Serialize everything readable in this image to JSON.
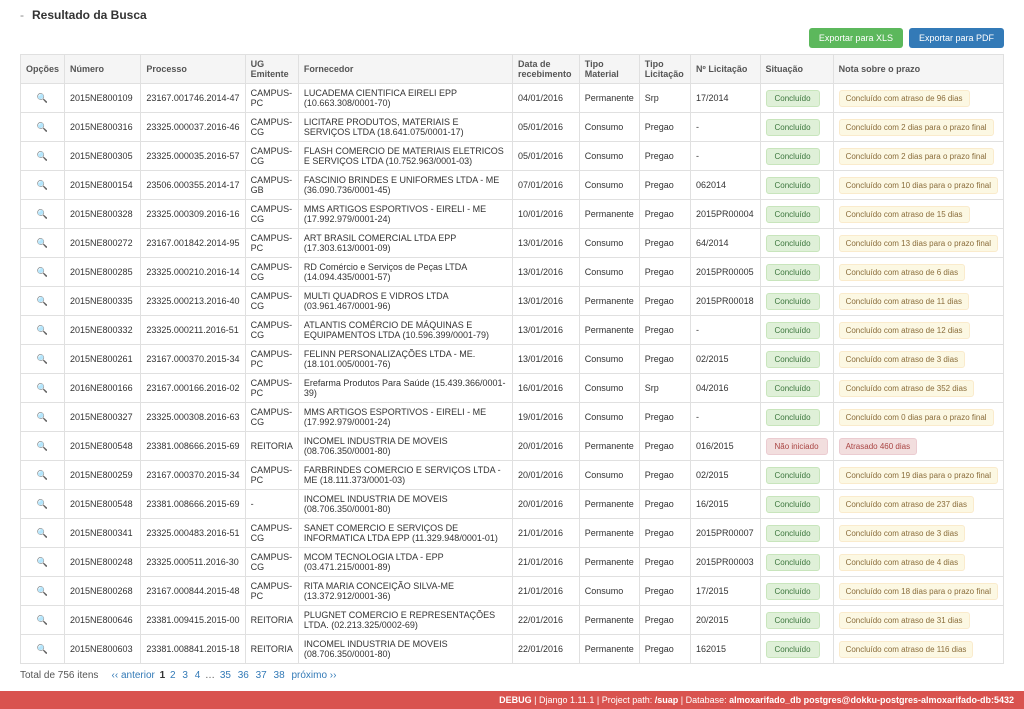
{
  "title": "Resultado da Busca",
  "buttons": {
    "export_xls": "Exportar para XLS",
    "export_pdf": "Exportar para PDF"
  },
  "columns": {
    "opcoes": "Opções",
    "numero": "Número",
    "processo": "Processo",
    "ug": "UG Emitente",
    "fornecedor": "Fornecedor",
    "data": "Data de recebimento",
    "tipo_material": "Tipo Material",
    "tipo_licitacao": "Tipo Licitação",
    "n_licitacao": "Nº Licitação",
    "situacao": "Situação",
    "nota": "Nota sobre o prazo"
  },
  "status_labels": {
    "concluido": "Concluído",
    "nao_iniciado": "Não iniciado"
  },
  "rows": [
    {
      "numero": "2015NE800109",
      "processo": "23167.001746.2014-47",
      "ug": "CAMPUS-PC",
      "fornecedor": "LUCADEMA CIENTIFICA EIRELI EPP (10.663.308/0001-70)",
      "data": "04/01/2016",
      "tipo_material": "Permanente",
      "tipo_licitacao": "Srp",
      "n_licitacao": "17/2014",
      "situacao": "concluido",
      "nota": "Concluído com atraso de 96 dias",
      "nota_tipo": "warn"
    },
    {
      "numero": "2015NE800316",
      "processo": "23325.000037.2016-46",
      "ug": "CAMPUS-CG",
      "fornecedor": "LICITARE PRODUTOS, MATERIAIS E SERVIÇOS LTDA (18.641.075/0001-17)",
      "data": "05/01/2016",
      "tipo_material": "Consumo",
      "tipo_licitacao": "Pregao",
      "n_licitacao": "-",
      "situacao": "concluido",
      "nota": "Concluído com 2 dias para o prazo final",
      "nota_tipo": "warn"
    },
    {
      "numero": "2015NE800305",
      "processo": "23325.000035.2016-57",
      "ug": "CAMPUS-CG",
      "fornecedor": "FLASH COMERCIO DE MATERIAIS ELETRICOS E SERVIÇOS LTDA (10.752.963/0001-03)",
      "data": "05/01/2016",
      "tipo_material": "Consumo",
      "tipo_licitacao": "Pregao",
      "n_licitacao": "-",
      "situacao": "concluido",
      "nota": "Concluído com 2 dias para o prazo final",
      "nota_tipo": "warn"
    },
    {
      "numero": "2015NE800154",
      "processo": "23506.000355.2014-17",
      "ug": "CAMPUS-GB",
      "fornecedor": "FASCINIO BRINDES E UNIFORMES LTDA - ME (36.090.736/0001-45)",
      "data": "07/01/2016",
      "tipo_material": "Consumo",
      "tipo_licitacao": "Pregao",
      "n_licitacao": "062014",
      "situacao": "concluido",
      "nota": "Concluído com 10 dias para o prazo final",
      "nota_tipo": "warn"
    },
    {
      "numero": "2015NE800328",
      "processo": "23325.000309.2016-16",
      "ug": "CAMPUS-CG",
      "fornecedor": "MMS ARTIGOS ESPORTIVOS - EIRELI - ME (17.992.979/0001-24)",
      "data": "10/01/2016",
      "tipo_material": "Permanente",
      "tipo_licitacao": "Pregao",
      "n_licitacao": "2015PR00004",
      "situacao": "concluido",
      "nota": "Concluído com atraso de 15 dias",
      "nota_tipo": "warn"
    },
    {
      "numero": "2015NE800272",
      "processo": "23167.001842.2014-95",
      "ug": "CAMPUS-PC",
      "fornecedor": "ART BRASIL COMERCIAL LTDA EPP (17.303.613/0001-09)",
      "data": "13/01/2016",
      "tipo_material": "Consumo",
      "tipo_licitacao": "Pregao",
      "n_licitacao": "64/2014",
      "situacao": "concluido",
      "nota": "Concluído com 13 dias para o prazo final",
      "nota_tipo": "warn"
    },
    {
      "numero": "2015NE800285",
      "processo": "23325.000210.2016-14",
      "ug": "CAMPUS-CG",
      "fornecedor": "RD Comércio e Serviços de Peças LTDA (14.094.435/0001-57)",
      "data": "13/01/2016",
      "tipo_material": "Consumo",
      "tipo_licitacao": "Pregao",
      "n_licitacao": "2015PR00005",
      "situacao": "concluido",
      "nota": "Concluído com atraso de 6 dias",
      "nota_tipo": "warn"
    },
    {
      "numero": "2015NE800335",
      "processo": "23325.000213.2016-40",
      "ug": "CAMPUS-CG",
      "fornecedor": "MULTI QUADROS E VIDROS LTDA (03.961.467/0001-96)",
      "data": "13/01/2016",
      "tipo_material": "Permanente",
      "tipo_licitacao": "Pregao",
      "n_licitacao": "2015PR00018",
      "situacao": "concluido",
      "nota": "Concluído com atraso de 11 dias",
      "nota_tipo": "warn"
    },
    {
      "numero": "2015NE800332",
      "processo": "23325.000211.2016-51",
      "ug": "CAMPUS-CG",
      "fornecedor": "ATLANTIS COMÉRCIO DE MÁQUINAS E EQUIPAMENTOS LTDA (10.596.399/0001-79)",
      "data": "13/01/2016",
      "tipo_material": "Permanente",
      "tipo_licitacao": "Pregao",
      "n_licitacao": "-",
      "situacao": "concluido",
      "nota": "Concluído com atraso de 12 dias",
      "nota_tipo": "warn"
    },
    {
      "numero": "2015NE800261",
      "processo": "23167.000370.2015-34",
      "ug": "CAMPUS-PC",
      "fornecedor": "FELINN PERSONALIZAÇÕES LTDA - ME. (18.101.005/0001-76)",
      "data": "13/01/2016",
      "tipo_material": "Consumo",
      "tipo_licitacao": "Pregao",
      "n_licitacao": "02/2015",
      "situacao": "concluido",
      "nota": "Concluído com atraso de 3 dias",
      "nota_tipo": "warn"
    },
    {
      "numero": "2016NE800166",
      "processo": "23167.000166.2016-02",
      "ug": "CAMPUS-PC",
      "fornecedor": "Erefarma Produtos Para Saúde (15.439.366/0001-39)",
      "data": "16/01/2016",
      "tipo_material": "Consumo",
      "tipo_licitacao": "Srp",
      "n_licitacao": "04/2016",
      "situacao": "concluido",
      "nota": "Concluído com atraso de 352 dias",
      "nota_tipo": "warn"
    },
    {
      "numero": "2015NE800327",
      "processo": "23325.000308.2016-63",
      "ug": "CAMPUS-CG",
      "fornecedor": "MMS ARTIGOS ESPORTIVOS - EIRELI - ME (17.992.979/0001-24)",
      "data": "19/01/2016",
      "tipo_material": "Consumo",
      "tipo_licitacao": "Pregao",
      "n_licitacao": "-",
      "situacao": "concluido",
      "nota": "Concluído com 0 dias para o prazo final",
      "nota_tipo": "warn"
    },
    {
      "numero": "2015NE800548",
      "processo": "23381.008666.2015-69",
      "ug": "REITORIA",
      "fornecedor": "INCOMEL INDUSTRIA DE MOVEIS (08.706.350/0001-80)",
      "data": "20/01/2016",
      "tipo_material": "Permanente",
      "tipo_licitacao": "Pregao",
      "n_licitacao": "016/2015",
      "situacao": "nao_iniciado",
      "nota": "Atrasado 460 dias",
      "nota_tipo": "danger"
    },
    {
      "numero": "2015NE800259",
      "processo": "23167.000370.2015-34",
      "ug": "CAMPUS-PC",
      "fornecedor": "FARBRINDES COMERCIO E SERVIÇOS LTDA - ME (18.111.373/0001-03)",
      "data": "20/01/2016",
      "tipo_material": "Consumo",
      "tipo_licitacao": "Pregao",
      "n_licitacao": "02/2015",
      "situacao": "concluido",
      "nota": "Concluído com 19 dias para o prazo final",
      "nota_tipo": "warn"
    },
    {
      "numero": "2015NE800548",
      "processo": "23381.008666.2015-69",
      "ug": "-",
      "fornecedor": "INCOMEL INDUSTRIA DE MOVEIS (08.706.350/0001-80)",
      "data": "20/01/2016",
      "tipo_material": "Permanente",
      "tipo_licitacao": "Pregao",
      "n_licitacao": "16/2015",
      "situacao": "concluido",
      "nota": "Concluído com atraso de 237 dias",
      "nota_tipo": "warn"
    },
    {
      "numero": "2015NE800341",
      "processo": "23325.000483.2016-51",
      "ug": "CAMPUS-CG",
      "fornecedor": "SANET COMERCIO E SERVIÇOS DE INFORMATICA LTDA EPP (11.329.948/0001-01)",
      "data": "21/01/2016",
      "tipo_material": "Permanente",
      "tipo_licitacao": "Pregao",
      "n_licitacao": "2015PR00007",
      "situacao": "concluido",
      "nota": "Concluído com atraso de 3 dias",
      "nota_tipo": "warn"
    },
    {
      "numero": "2015NE800248",
      "processo": "23325.000511.2016-30",
      "ug": "CAMPUS-CG",
      "fornecedor": "MCOM TECNOLOGIA LTDA - EPP (03.471.215/0001-89)",
      "data": "21/01/2016",
      "tipo_material": "Permanente",
      "tipo_licitacao": "Pregao",
      "n_licitacao": "2015PR00003",
      "situacao": "concluido",
      "nota": "Concluído com atraso de 4 dias",
      "nota_tipo": "warn"
    },
    {
      "numero": "2015NE800268",
      "processo": "23167.000844.2015-48",
      "ug": "CAMPUS-PC",
      "fornecedor": "RITA MARIA CONCEIÇÃO SILVA-ME (13.372.912/0001-36)",
      "data": "21/01/2016",
      "tipo_material": "Consumo",
      "tipo_licitacao": "Pregao",
      "n_licitacao": "17/2015",
      "situacao": "concluido",
      "nota": "Concluído com 18 dias para o prazo final",
      "nota_tipo": "warn"
    },
    {
      "numero": "2015NE800646",
      "processo": "23381.009415.2015-00",
      "ug": "REITORIA",
      "fornecedor": "PLUGNET COMERCIO E REPRESENTAÇÕES LTDA. (02.213.325/0002-69)",
      "data": "22/01/2016",
      "tipo_material": "Permanente",
      "tipo_licitacao": "Pregao",
      "n_licitacao": "20/2015",
      "situacao": "concluido",
      "nota": "Concluído com atraso de 31 dias",
      "nota_tipo": "warn"
    },
    {
      "numero": "2015NE800603",
      "processo": "23381.008841.2015-18",
      "ug": "REITORIA",
      "fornecedor": "INCOMEL INDUSTRIA DE MOVEIS (08.706.350/0001-80)",
      "data": "22/01/2016",
      "tipo_material": "Permanente",
      "tipo_licitacao": "Pregao",
      "n_licitacao": "162015",
      "situacao": "concluido",
      "nota": "Concluído com atraso de 116 dias",
      "nota_tipo": "warn"
    }
  ],
  "pager": {
    "total_text": "Total de 756 itens",
    "prev": "‹‹ anterior",
    "pages_start": [
      "1",
      "2",
      "3",
      "4"
    ],
    "ellipsis": "…",
    "pages_end": [
      "35",
      "36",
      "37",
      "38"
    ],
    "next": "próximo ››"
  },
  "debug": {
    "label_debug": "DEBUG",
    "django": "Django 1.11.1",
    "project_label": "Project path:",
    "project": "/suap",
    "db_label": "Database:",
    "db": "almoxarifado_db postgres@dokku-postgres-almoxarifado-db:5432"
  }
}
